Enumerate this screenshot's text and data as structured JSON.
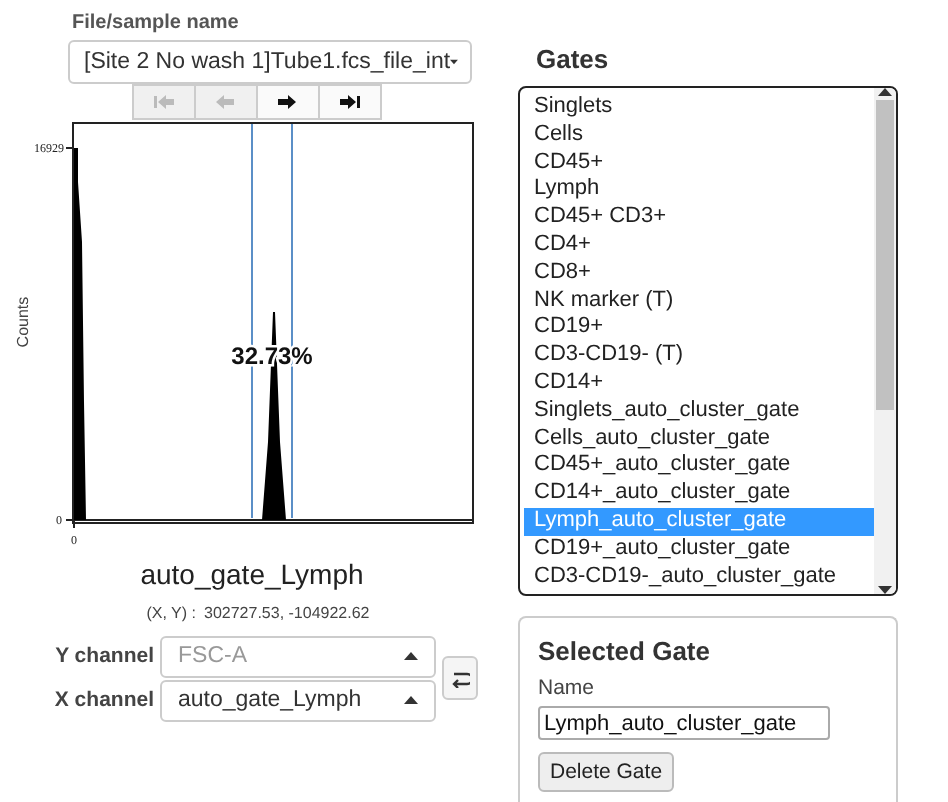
{
  "sample": {
    "label": "File/sample name",
    "value": "[Site 2 No wash 1]Tube1.fcs_file_int"
  },
  "nav_buttons": [
    {
      "kind": "first",
      "disabled": true
    },
    {
      "kind": "previous",
      "disabled": true
    },
    {
      "kind": "next",
      "disabled": false
    },
    {
      "kind": "last",
      "disabled": false
    }
  ],
  "plot": {
    "y_label": "Counts",
    "y_ticks": [
      "16929",
      "0"
    ],
    "x_ticks": [
      "0"
    ],
    "gate_percent": "32.73%",
    "title": "auto_gate_Lymph"
  },
  "coordinates": {
    "label": "(X, Y) :",
    "value": "302727.53, -104922.62"
  },
  "channels": [
    {
      "label": "Y channel",
      "placeholder": "FSC-A"
    },
    {
      "label": "X channel",
      "value": "auto_gate_Lymph"
    }
  ],
  "gates": {
    "title": "Gates",
    "items": [
      {
        "label": "Singlets",
        "selected": false
      },
      {
        "label": "Cells",
        "selected": false
      },
      {
        "label": "CD45+",
        "selected": false
      },
      {
        "label": "Lymph",
        "selected": false
      },
      {
        "label": "CD45+ CD3+",
        "selected": false
      },
      {
        "label": "CD4+",
        "selected": false
      },
      {
        "label": "CD8+",
        "selected": false
      },
      {
        "label": "NK marker (T)",
        "selected": false
      },
      {
        "label": "CD19+",
        "selected": false
      },
      {
        "label": "CD3-CD19- (T)",
        "selected": false
      },
      {
        "label": "CD14+",
        "selected": false
      },
      {
        "label": "Singlets_auto_cluster_gate",
        "selected": false
      },
      {
        "label": "Cells_auto_cluster_gate",
        "selected": false
      },
      {
        "label": "CD45+_auto_cluster_gate",
        "selected": false
      },
      {
        "label": "CD14+_auto_cluster_gate",
        "selected": false
      },
      {
        "label": "Lymph_auto_cluster_gate",
        "selected": true
      },
      {
        "label": "CD19+_auto_cluster_gate",
        "selected": false
      },
      {
        "label": "CD3-CD19-_auto_cluster_gate",
        "selected": false
      }
    ]
  },
  "selected_gate": {
    "title": "Selected Gate",
    "name_label": "Name",
    "name_value": "Lymph_auto_cluster_gate",
    "delete_button": "Delete Gate"
  }
}
